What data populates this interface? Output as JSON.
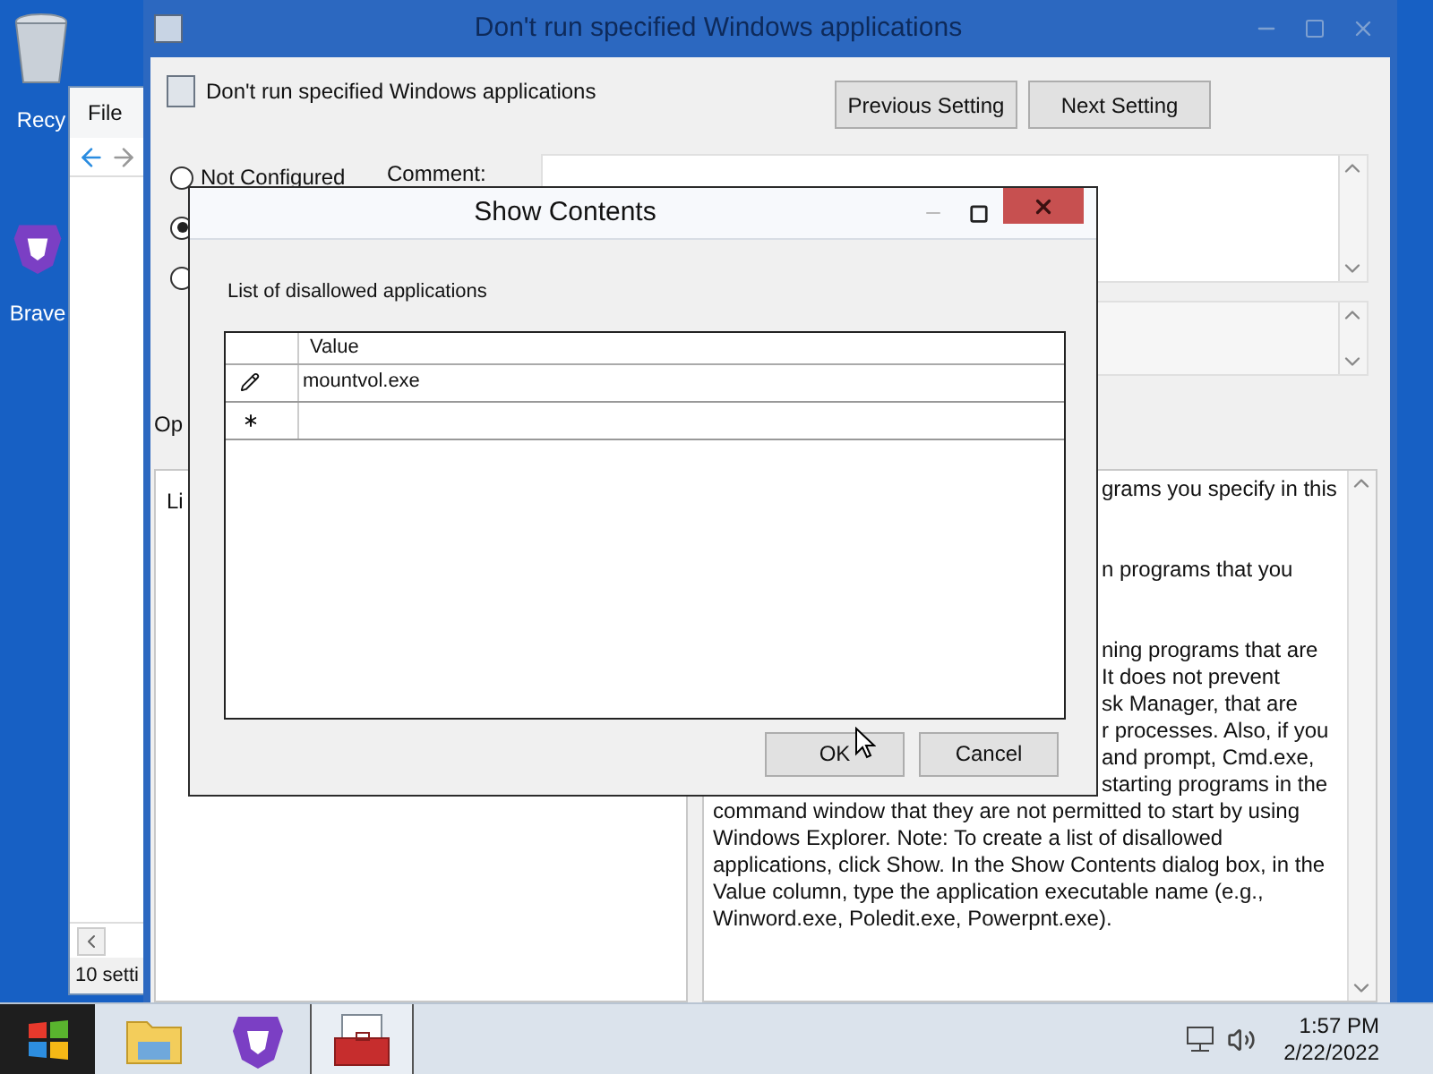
{
  "desktop_icons": [
    {
      "kind": "recycle",
      "label": "Recy"
    },
    {
      "kind": "brave",
      "label": "Brave"
    }
  ],
  "back_window": {
    "menu": [
      "File"
    ],
    "status": "10 setti"
  },
  "main_window": {
    "title": "Don't run specified Windows applications",
    "header": "Don't run specified Windows applications",
    "buttons": [
      "Previous Setting",
      "Next Setting"
    ],
    "radios": [
      {
        "label": "Not Configured",
        "selected": false
      },
      {
        "selected": true
      },
      {
        "selected": false
      }
    ],
    "comment_label": "Comment:",
    "options_label": "Op",
    "options_text": "Li",
    "help_fragments": [
      [
        "grams you specify in this"
      ],
      [
        "n programs that you"
      ],
      [
        "ning programs that are",
        "It does not prevent",
        "sk Manager, that are",
        "r processes. Also, if you",
        "and prompt, Cmd.exe,",
        "starting programs in the"
      ]
    ],
    "help_text": "command window that they are not permitted to start by using Windows Explorer. Note: To create a list of disallowed applications, click Show. In the Show Contents dialog box, in the Value column, type the application executable name (e.g., Winword.exe, Poledit.exe, Powerpnt.exe)."
  },
  "dialog": {
    "title": "Show Contents",
    "label": "List of disallowed applications",
    "column": "Value",
    "rows": [
      {
        "kind": "edit",
        "value": "mountvol.exe"
      },
      {
        "kind": "new"
      }
    ],
    "buttons": [
      "OK",
      "Cancel"
    ]
  },
  "taskbar": {
    "apps": [
      {
        "kind": "explorer",
        "selected": false
      },
      {
        "kind": "brave",
        "selected": false
      },
      {
        "kind": "toolbox",
        "selected": true
      }
    ],
    "time": "1:57 PM",
    "date": "2/22/2022"
  }
}
